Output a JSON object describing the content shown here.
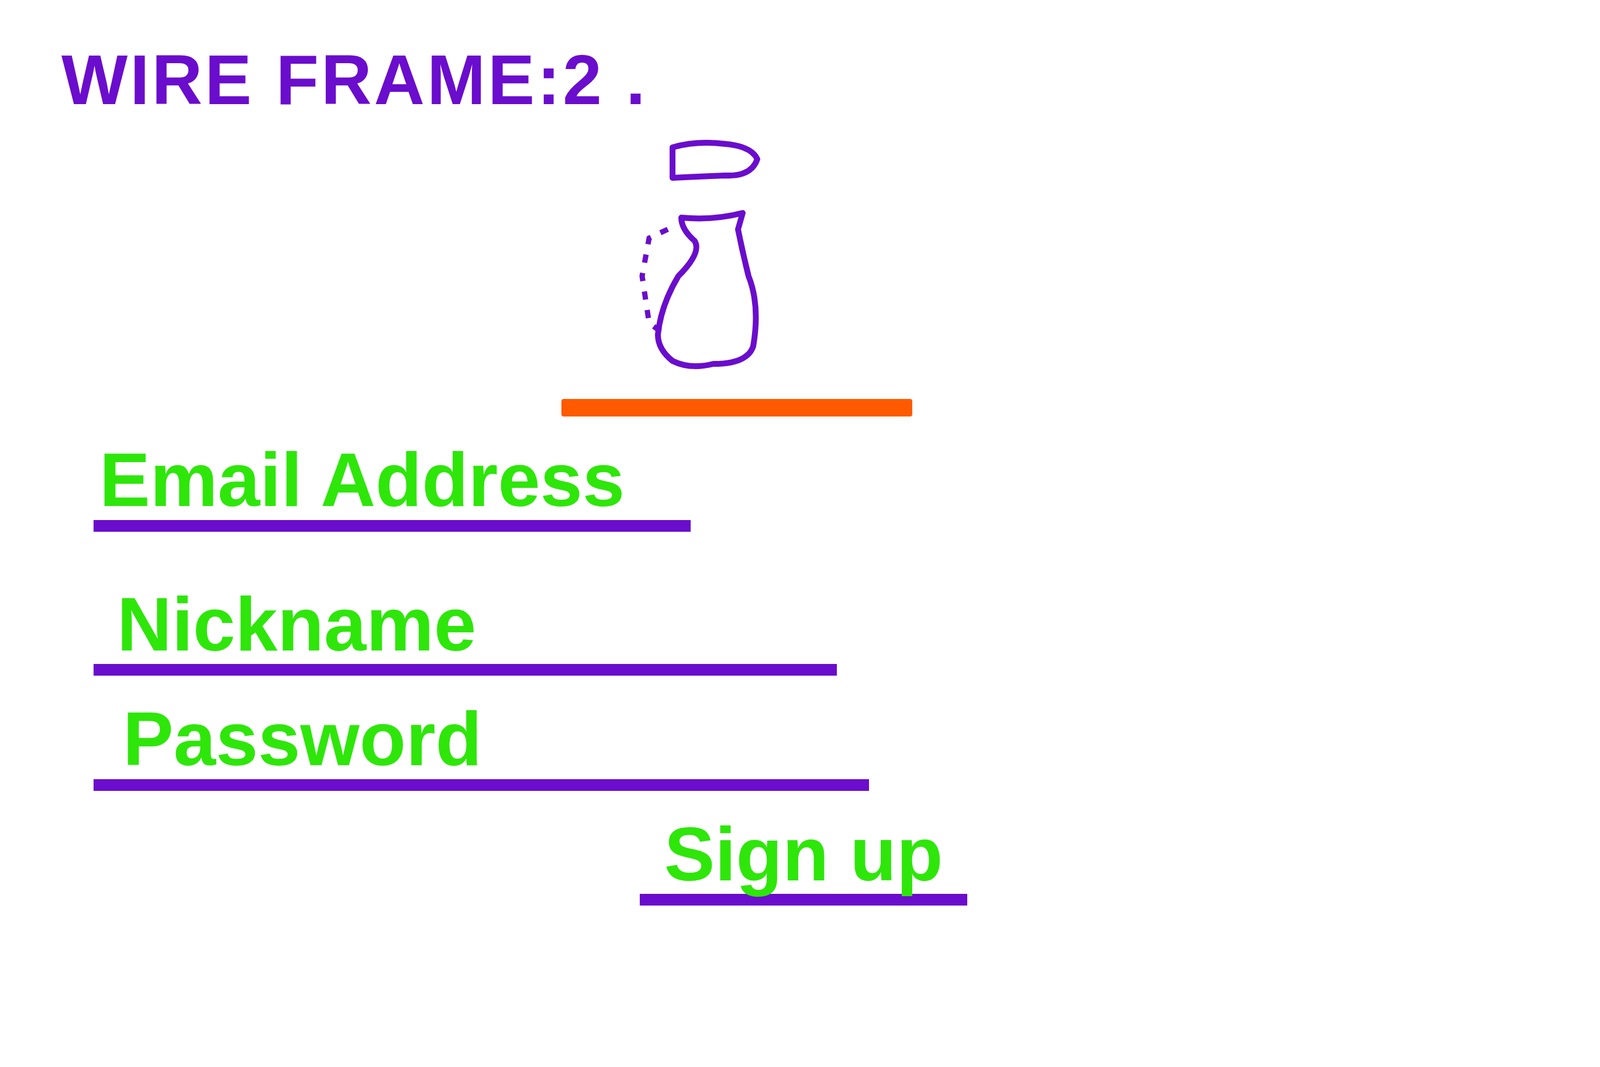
{
  "title": "WIRE FRAME:2 .",
  "form": {
    "fields": [
      {
        "label": "Email Address"
      },
      {
        "label": "Nickname"
      },
      {
        "label": "Password"
      }
    ],
    "submit": {
      "label": "Sign up"
    }
  }
}
